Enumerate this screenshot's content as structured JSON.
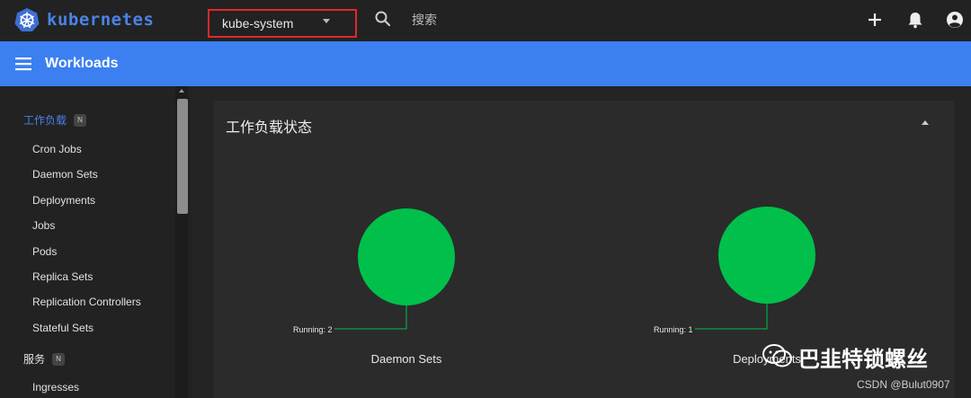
{
  "app": {
    "logo_text": "kubernetes"
  },
  "topbar": {
    "namespace": "kube-system",
    "search_placeholder": "搜索",
    "icons": [
      "plus-icon",
      "bell-icon",
      "account-icon"
    ]
  },
  "header": {
    "title": "Workloads"
  },
  "sidebar": {
    "section_workloads": {
      "label": "工作负载",
      "badge": "N"
    },
    "workload_items": [
      "Cron Jobs",
      "Daemon Sets",
      "Deployments",
      "Jobs",
      "Pods",
      "Replica Sets",
      "Replication Controllers",
      "Stateful Sets"
    ],
    "section_services": {
      "label": "服务",
      "badge": "N"
    },
    "service_items": [
      "Ingresses"
    ]
  },
  "card": {
    "title": "工作负载状态",
    "charts": [
      {
        "label": "Daemon Sets",
        "legend": "Running: 2"
      },
      {
        "label": "Deployments",
        "legend": "Running: 1"
      }
    ]
  },
  "chart_data": [
    {
      "type": "pie",
      "title": "Daemon Sets",
      "categories": [
        "Running"
      ],
      "values": [
        2
      ],
      "legend_label": "Running: 2"
    },
    {
      "type": "pie",
      "title": "Deployments",
      "categories": [
        "Running"
      ],
      "values": [
        1
      ],
      "legend_label": "Running: 1"
    }
  ],
  "colors": {
    "accent": "#3c7ff0",
    "running": "#00c04b",
    "namespace_highlight": "#e0282a",
    "active_nav": "#4a82e6"
  },
  "watermark": {
    "wechat_text": "巴韭特锁螺丝",
    "csdn_text": "CSDN @Bulut0907"
  }
}
